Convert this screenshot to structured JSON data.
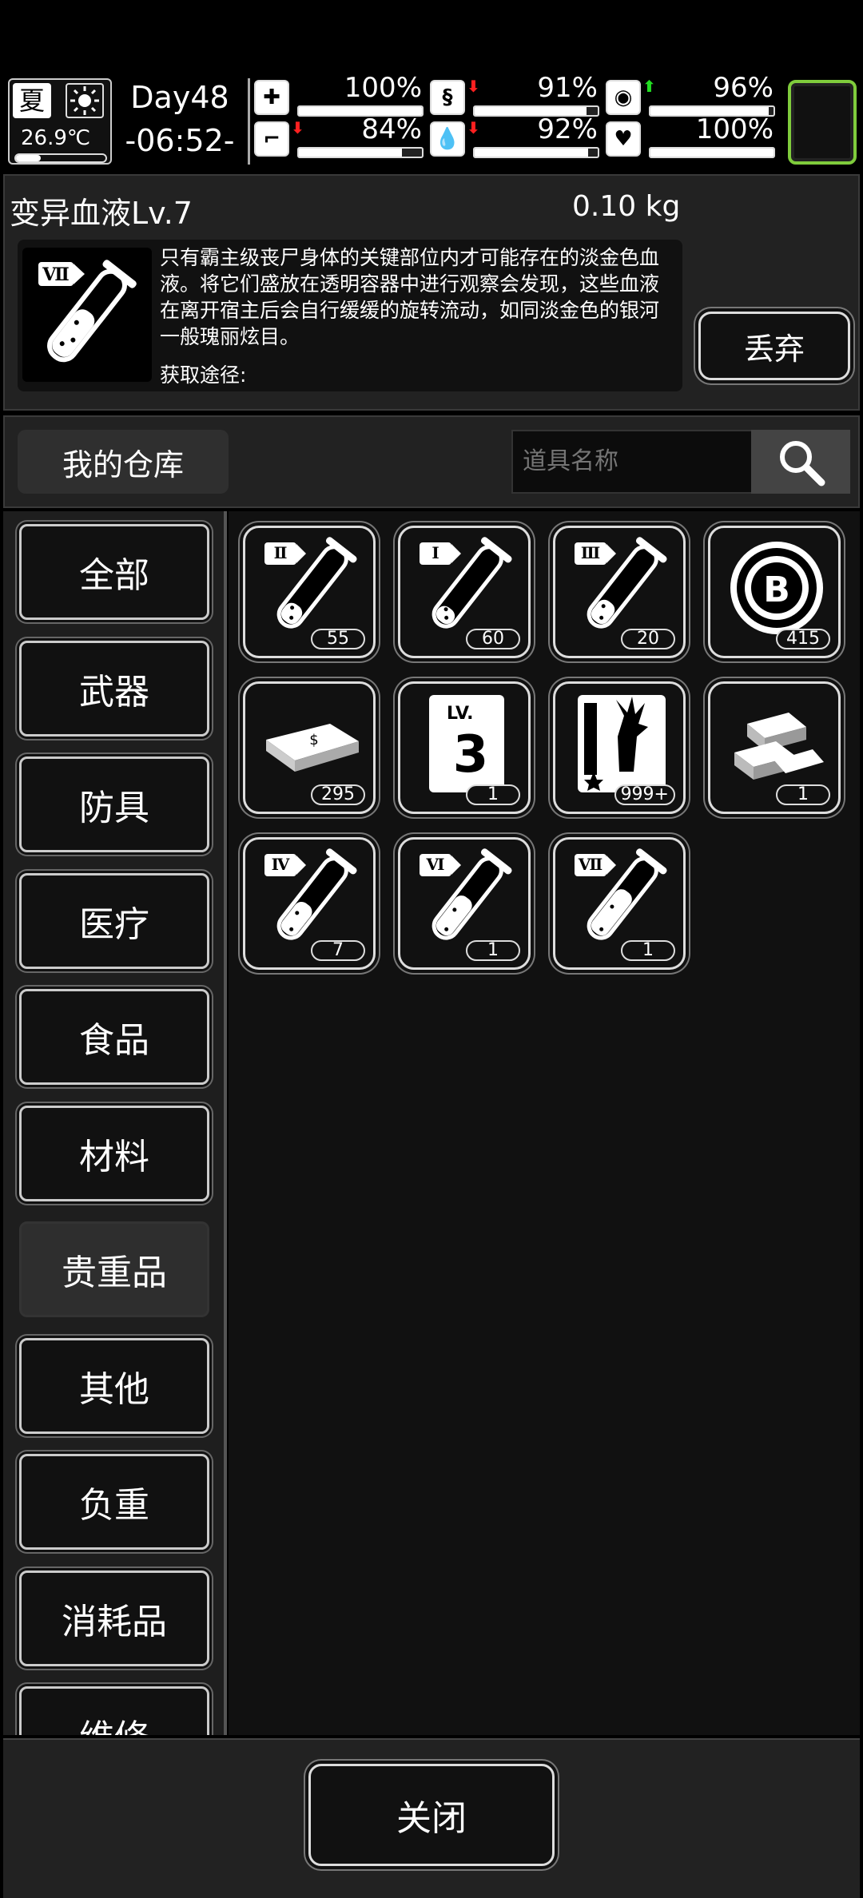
{
  "hud": {
    "season": "夏",
    "temperature": "26.9℃",
    "day": "Day48",
    "time": "-06:52-",
    "stats": [
      {
        "icon": "first-aid-icon",
        "value": "100%",
        "level": 1.0,
        "trend": ""
      },
      {
        "icon": "stomach-icon",
        "value": "91%",
        "level": 0.91,
        "trend": "down"
      },
      {
        "icon": "pill-icon",
        "value": "96%",
        "level": 0.96,
        "trend": "up"
      },
      {
        "icon": "foot-icon",
        "value": "84%",
        "level": 0.84,
        "trend": "down"
      },
      {
        "icon": "water-drop-icon",
        "value": "92%",
        "level": 0.92,
        "trend": "down"
      },
      {
        "icon": "heart-icon",
        "value": "100%",
        "level": 1.0,
        "trend": ""
      }
    ]
  },
  "item_detail": {
    "name": "变异血液Lv.7",
    "weight": "0.10 kg",
    "icon_label": "Ⅶ",
    "description": "只有霸主级丧尸身体的关键部位内才可能存在的淡金色血液。将它们盛放在透明容器中进行观察会发现，这些血液在离开宿主后会自行缓缓的旋转流动，如同淡金色的银河一般瑰丽炫目。",
    "source_label": "获取途径:",
    "discard_label": "丢弃"
  },
  "storage": {
    "title": "我的仓库",
    "search_placeholder": "道具名称"
  },
  "categories": [
    "全部",
    "武器",
    "防具",
    "医疗",
    "食品",
    "材料",
    "贵重品",
    "其他",
    "负重",
    "消耗品",
    "维修"
  ],
  "active_category": "贵重品",
  "items": [
    {
      "name": "blood-vial-2",
      "label": "Ⅱ",
      "count": "55",
      "type": "vial",
      "level": 0.25
    },
    {
      "name": "blood-vial-1",
      "label": "Ⅰ",
      "count": "60",
      "type": "vial",
      "level": 0.2
    },
    {
      "name": "blood-vial-3",
      "label": "Ⅲ",
      "count": "20",
      "type": "vial",
      "level": 0.3
    },
    {
      "name": "b-coin",
      "label": "B",
      "count": "415",
      "type": "coin"
    },
    {
      "name": "cash-stack",
      "label": "",
      "count": "295",
      "type": "cash"
    },
    {
      "name": "level-3-manual",
      "label": "LV.3",
      "count": "1",
      "type": "card"
    },
    {
      "name": "zombie-hand-card",
      "label": "",
      "count": "999+",
      "type": "hand"
    },
    {
      "name": "gold-bars",
      "label": "",
      "count": "1",
      "type": "gold"
    },
    {
      "name": "blood-vial-4",
      "label": "Ⅳ",
      "count": "7",
      "type": "vial",
      "level": 0.45
    },
    {
      "name": "blood-vial-6",
      "label": "Ⅵ",
      "count": "1",
      "type": "vial",
      "level": 0.55
    },
    {
      "name": "blood-vial-7",
      "label": "Ⅶ",
      "count": "1",
      "type": "vial",
      "level": 0.65
    }
  ],
  "close_label": "关闭"
}
